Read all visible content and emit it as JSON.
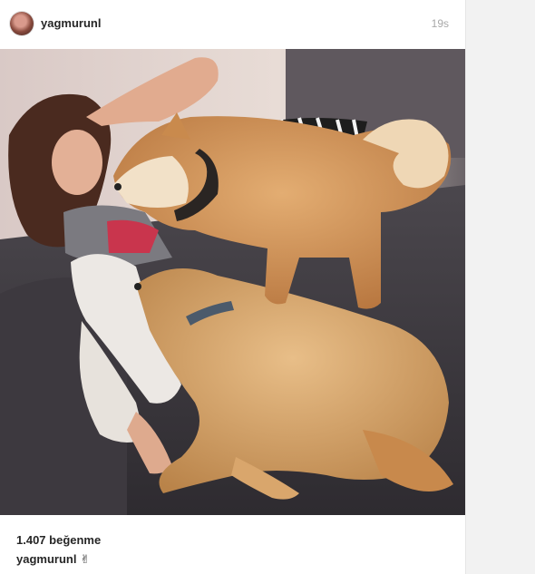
{
  "post": {
    "username": "yagmurunl",
    "time_ago": "19s",
    "likes_text": "1.407 beğenme",
    "caption_author": "yagmurunl",
    "caption_emoji": "✌"
  },
  "icons": {
    "avatar": "profile-avatar",
    "caption_emoji": "victory-hand-icon"
  },
  "colors": {
    "text": "#262626",
    "muted": "#a8a8a8",
    "background": "#ffffff"
  }
}
